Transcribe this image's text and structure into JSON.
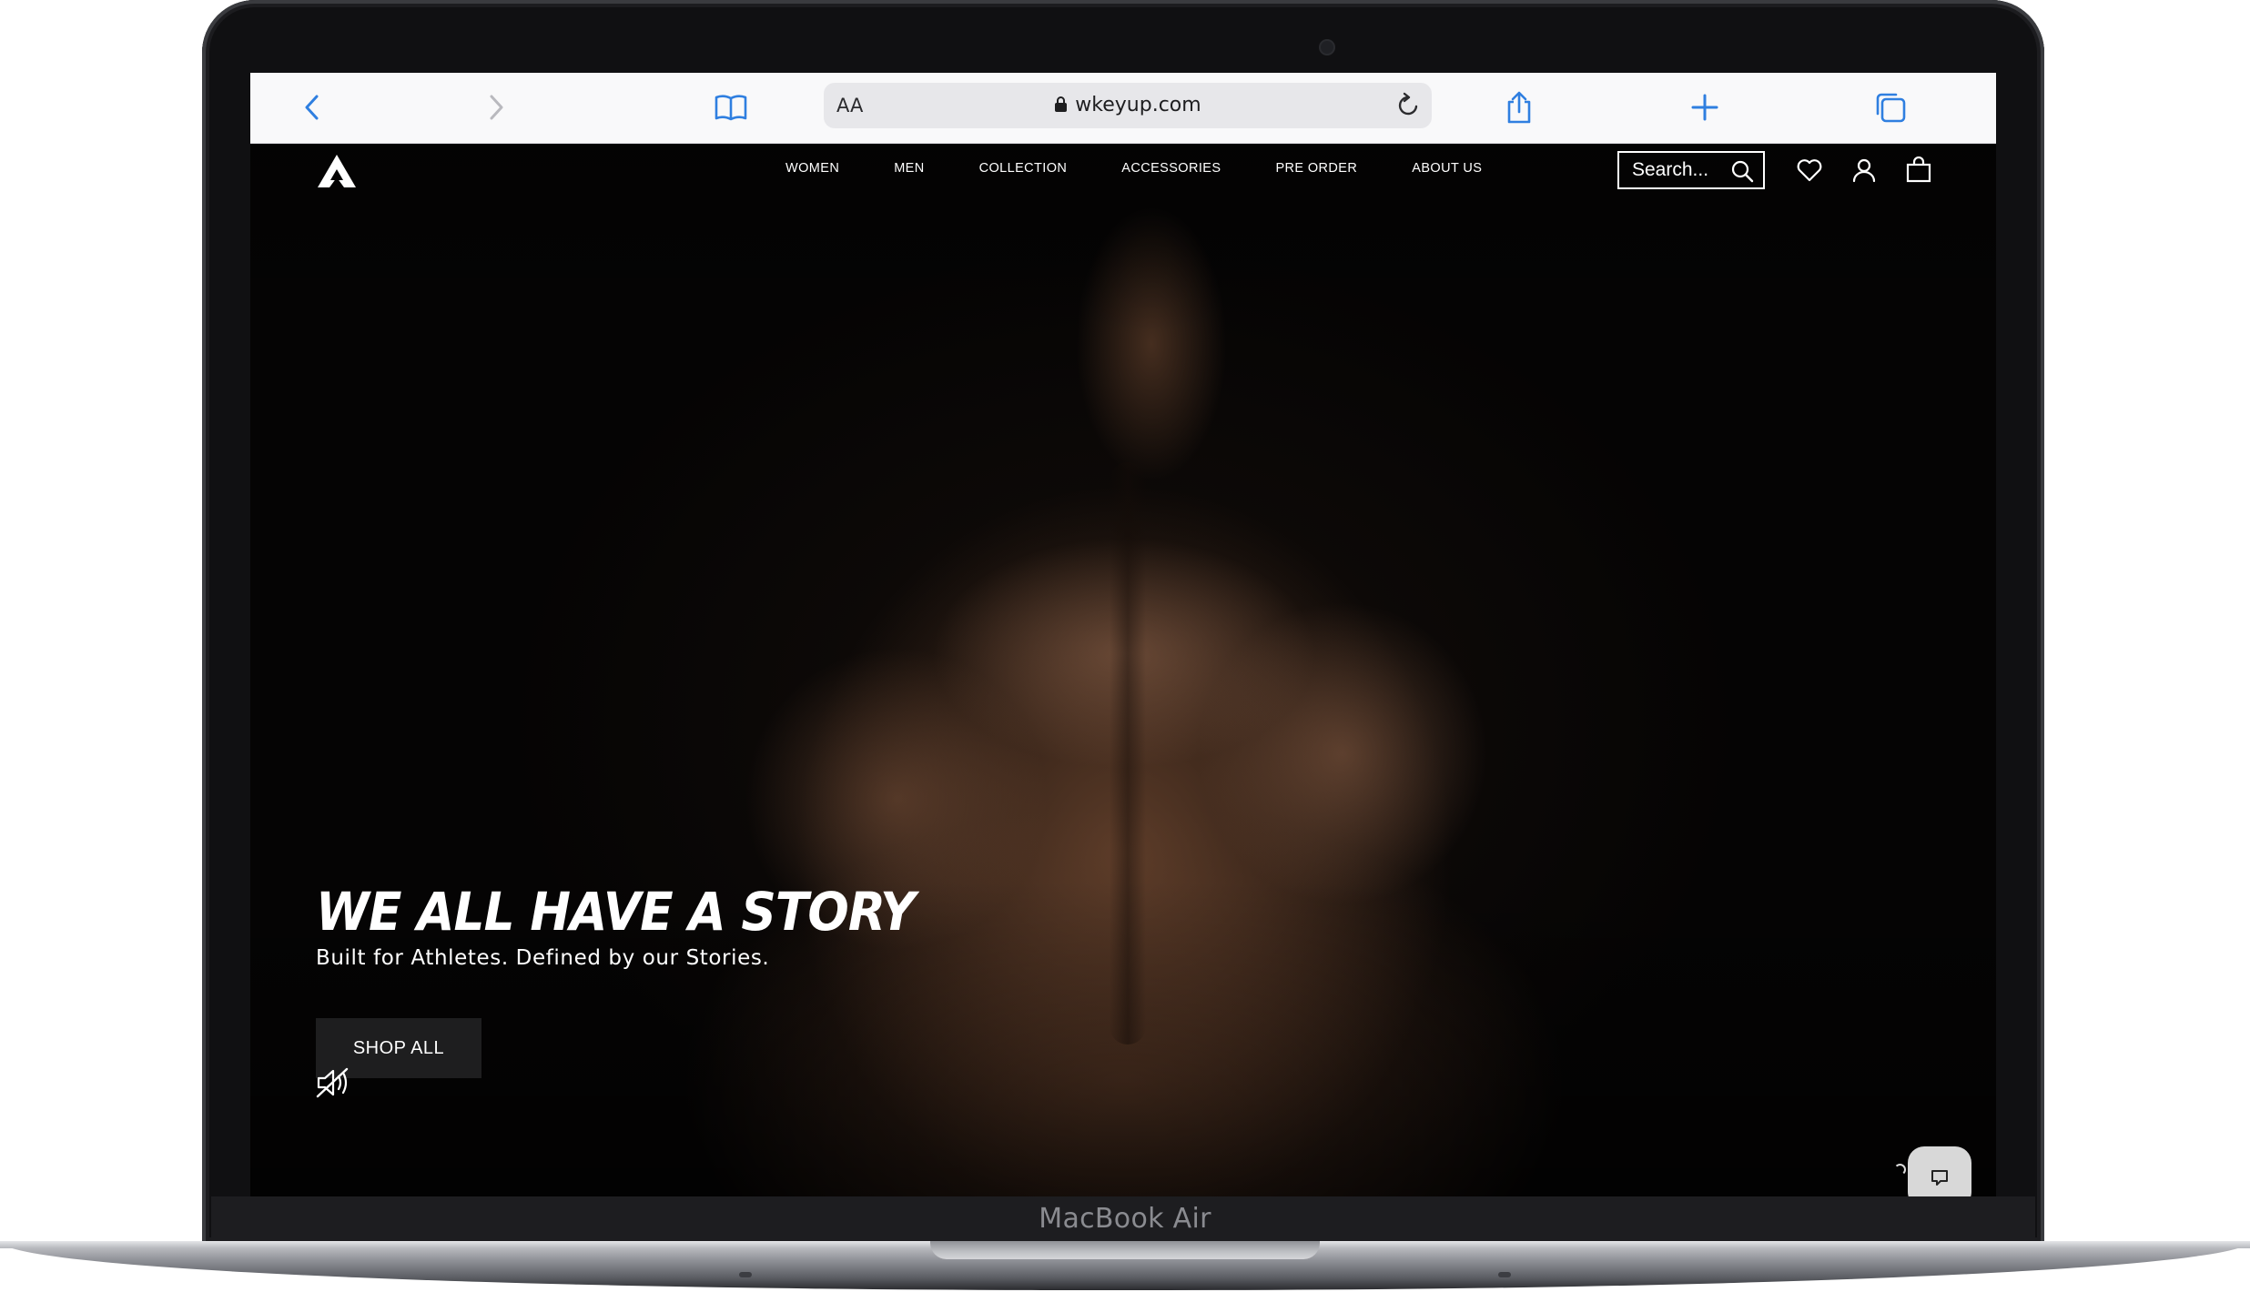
{
  "device": {
    "model_label": "MacBook Air"
  },
  "browser": {
    "url": "wkeyup.com",
    "reader_label": "AA",
    "icons": [
      "chevron-left-icon",
      "chevron-right-icon",
      "book-icon",
      "lock-icon",
      "reload-icon",
      "share-icon",
      "plus-icon",
      "tabs-icon"
    ],
    "accent_color": "#2f7fe0"
  },
  "site": {
    "logo_icon": "arrow-up-logo-icon",
    "nav": [
      "WOMEN",
      "MEN",
      "COLLECTION",
      "ACCESSORIES",
      "PRE ORDER",
      "ABOUT US"
    ],
    "search_placeholder": "Search...",
    "header_icons": [
      "search-icon",
      "heart-icon",
      "user-icon",
      "bag-icon"
    ]
  },
  "hero": {
    "title": "WE ALL HAVE A STORY",
    "subtitle": "Built for Athletes. Defined by our Stories.",
    "cta_label": "SHOP ALL",
    "mute_icon": "muted-speaker-icon",
    "chat_icon": "chat-bubble-icon"
  }
}
